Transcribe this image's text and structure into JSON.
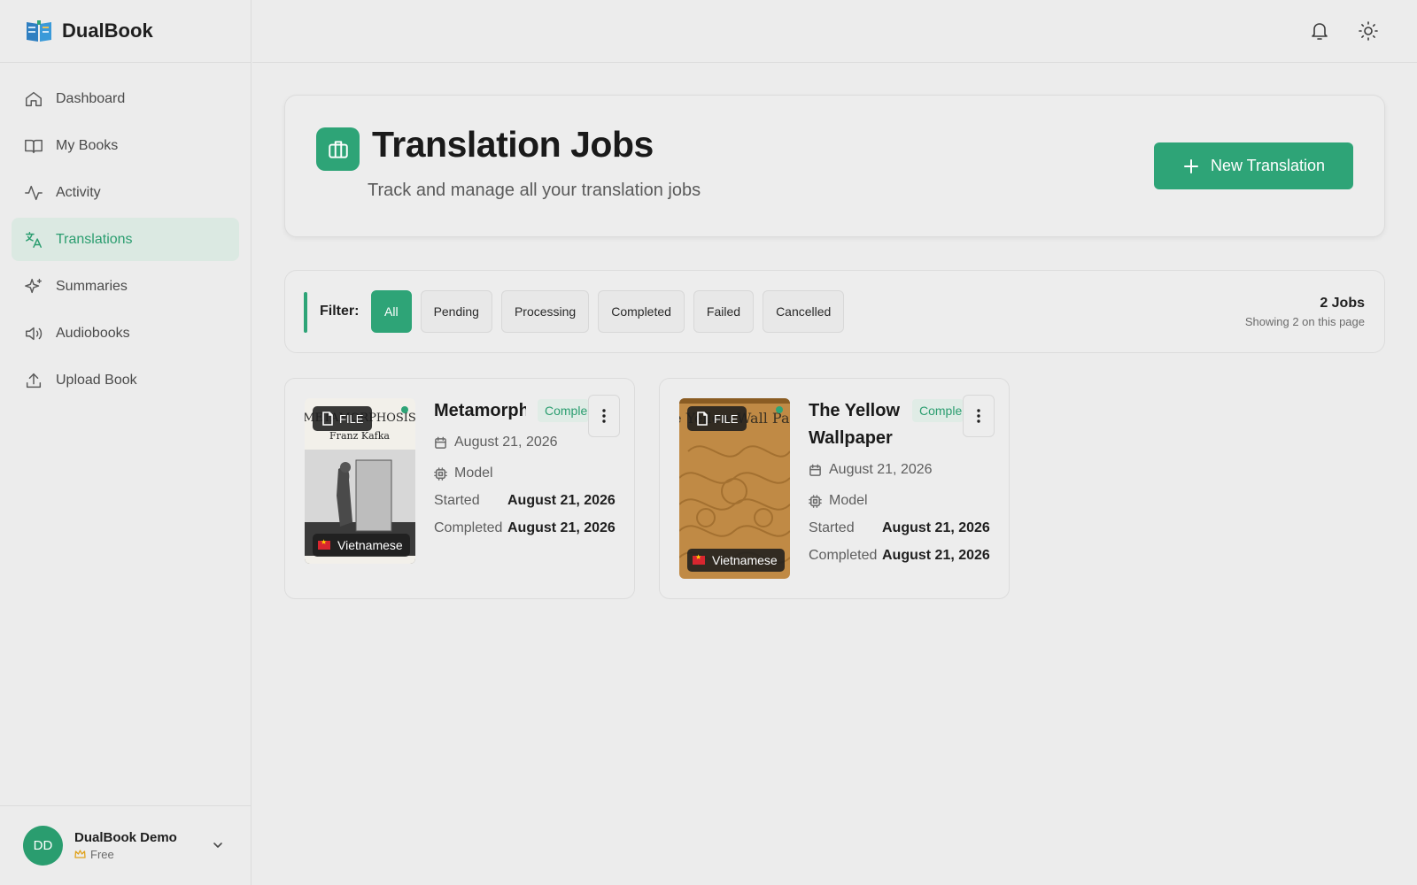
{
  "app": {
    "name": "DualBook"
  },
  "sidebar": {
    "items": [
      {
        "label": "Dashboard",
        "icon": "home-icon"
      },
      {
        "label": "My Books",
        "icon": "book-open-icon"
      },
      {
        "label": "Activity",
        "icon": "activity-icon"
      },
      {
        "label": "Translations",
        "icon": "translate-icon",
        "active": true
      },
      {
        "label": "Summaries",
        "icon": "sparkles-icon"
      },
      {
        "label": "Audiobooks",
        "icon": "speaker-icon"
      },
      {
        "label": "Upload Book",
        "icon": "upload-icon"
      }
    ],
    "user": {
      "initials": "DD",
      "name": "DualBook Demo",
      "plan": "Free"
    }
  },
  "header": {
    "title": "Translation Jobs",
    "subtitle": "Track and manage all your translation jobs",
    "new_button": "New Translation"
  },
  "filter": {
    "label": "Filter:",
    "options": [
      "All",
      "Pending",
      "Processing",
      "Completed",
      "Failed",
      "Cancelled"
    ],
    "selected": "All",
    "count": "2 Jobs",
    "showing": "Showing 2 on this page"
  },
  "jobs": [
    {
      "title": "Metamorph",
      "status": "Comple",
      "file_badge": "FILE",
      "language": "Vietnamese",
      "date": "August 21, 2026",
      "model": "Model",
      "started_label": "Started",
      "started": "August 21, 2026",
      "completed_label": "Completed",
      "completed": "August 21, 2026",
      "cover_title": "METAMORPHOSIS",
      "cover_author": "Franz Kafka"
    },
    {
      "title_line1": "The Yellow",
      "title_line2": "Wallpaper",
      "status": "Comple",
      "file_badge": "FILE",
      "language": "Vietnamese",
      "date": "August 21, 2026",
      "model": "Model",
      "started_label": "Started",
      "started": "August 21, 2026",
      "completed_label": "Completed",
      "completed": "August 21, 2026",
      "cover_title": "The Yellow Wall Paper"
    }
  ],
  "colors": {
    "accent": "#2ea477",
    "active_bg": "#dbe9e2",
    "background": "#ececec"
  }
}
